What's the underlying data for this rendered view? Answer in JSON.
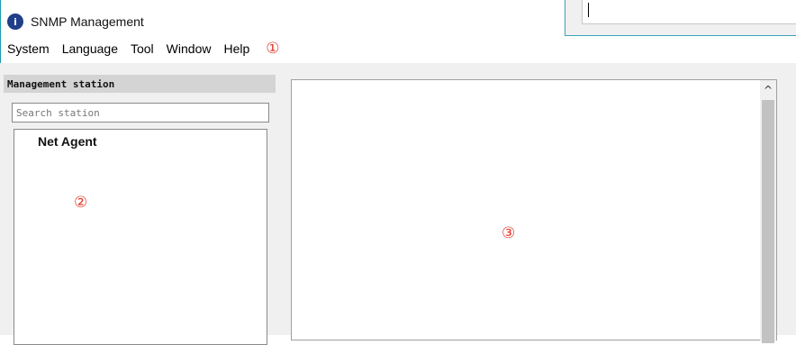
{
  "window": {
    "title": "SNMP Management",
    "icon": "app-logo-icon",
    "icon_glyph": "i"
  },
  "menubar": {
    "items": [
      "System",
      "Language",
      "Tool",
      "Window",
      "Help"
    ]
  },
  "annotations": {
    "marker1": "①",
    "marker2": "②",
    "marker3": "③",
    "color": "#e03a2a"
  },
  "management_station": {
    "header": "Management station",
    "search_placeholder": "Search station",
    "tree": [
      {
        "label": "Net Agent"
      }
    ]
  },
  "scrollbar": {
    "up_arrow": "^"
  },
  "colors": {
    "window_border": "#1a9bb0",
    "panel_bg": "#f0f0f0",
    "header_bg": "#d4d4d4"
  }
}
